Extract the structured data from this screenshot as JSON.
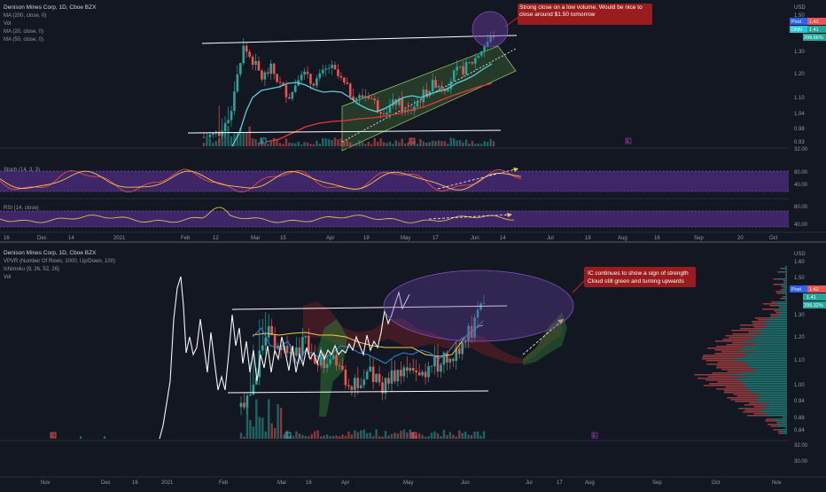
{
  "colors": {
    "background": "#131722",
    "grid": "#1f2330",
    "up": "#26a69a",
    "down": "#ef5350",
    "ma20": "#5ad1d9",
    "ma50": "#e53935",
    "channel": "#9ccc65",
    "purple_band": "#4a2b7a",
    "stoch_k": "#e84b4b",
    "stoch_d": "#f2c94c",
    "rsi": "#d4c04a",
    "annotation_bg": "#9b1c1c",
    "ellipse": "#7b4fb8",
    "label_blue": "#26c6da",
    "label_red": "#ef5350"
  },
  "top_panel": {
    "legend": [
      "Denison Mines Corp, 1D, Cboe BZX",
      "MA (200, close, 0)",
      "Vol",
      "MA (20, close, 0)",
      "MA (50, close, 0)"
    ],
    "currency": "USD",
    "price_ticks": [
      "1.50",
      "1.42",
      "1.41",
      "1.30",
      "1.20",
      "1.10",
      "1.04",
      "0.98",
      "0.93",
      "32.00"
    ],
    "post_label": "Post",
    "post_price": "1.42",
    "dnn_label": "DNN",
    "dnn_price": "1.41",
    "pct_label": "299.66%",
    "annotation": "Strong close on a low volume. Would be nice to close around $1.50 tomorrow",
    "stoch_legend": "Stoch (14, 3, 3)",
    "stoch_ticks": [
      "80.00",
      "40.00"
    ],
    "rsi_legend": "RSI (14, close)",
    "rsi_ticks": [
      "80.00",
      "40.00"
    ],
    "time_axis": [
      "16",
      "Dec",
      "14",
      "2021",
      "Feb",
      "12",
      "Mar",
      "15",
      "Apr",
      "19",
      "May",
      "17",
      "Jun",
      "14",
      "Jul",
      "19",
      "Aug",
      "16",
      "Sep",
      "20",
      "Oct"
    ],
    "marker_letters": [
      "E",
      "E",
      "E"
    ]
  },
  "bottom_panel": {
    "legend": [
      "Denison Mines Corp, 1D, Cboe BZX",
      "VPVR (Number Of Rows, 1000, Up/Down, 100)",
      "Ichimoku (9, 26, 52, 26)",
      "Vol"
    ],
    "currency": "USD",
    "price_ticks": [
      "1.60",
      "1.50",
      "1.42",
      "1.41",
      "1.30",
      "1.20",
      "1.10",
      "1.00",
      "0.94",
      "0.88",
      "0.84",
      "32.00",
      "30.00"
    ],
    "post_label": "Post",
    "post_price": "1.42",
    "dnn_label": "DNN",
    "dnn_price": "1.41",
    "pct_label": "299.32%",
    "annotation_line1": "IC continues to show a sign of strength",
    "annotation_line2": "Cloud still green and turning upwards",
    "time_axis": [
      "Nov",
      "Dec",
      "16",
      "2021",
      "Feb",
      "Mar",
      "16",
      "Apr",
      "May",
      "Jun",
      "Jul",
      "17",
      "Aug",
      "Sep",
      "Oct",
      "Nov"
    ],
    "marker_letters": [
      "E",
      "E",
      "E",
      "E"
    ]
  },
  "chart_data": [
    {
      "type": "candlestick",
      "title": "Denison Mines Corp, 1D, Cboe BZX",
      "ylim": [
        0.92,
        1.55
      ],
      "support_level": 0.98,
      "resistance_level": 1.4,
      "last_close": 1.41,
      "approx_closes": [
        0.96,
        0.97,
        0.99,
        1.1,
        1.36,
        1.3,
        1.22,
        1.26,
        1.18,
        1.14,
        1.26,
        1.2,
        1.22,
        1.27,
        1.22,
        1.16,
        1.13,
        1.15,
        1.09,
        1.08,
        1.12,
        1.06,
        1.11,
        1.16,
        1.2,
        1.18,
        1.24,
        1.26,
        1.3,
        1.36,
        1.41
      ],
      "volume_peak_month": "Feb",
      "stoch_range": [
        0,
        100
      ],
      "rsi_range": [
        20,
        90
      ]
    },
    {
      "type": "candlestick",
      "title": "Denison Mines Corp, 1D, Cboe BZX",
      "ylim": [
        0.82,
        1.62
      ],
      "support_level": 0.97,
      "resistance_level": 1.34,
      "last_close": 1.41,
      "ichimoku": "Ichimoku (9, 26, 52, 26)",
      "vpvr": "VPVR (Number Of Rows, 1000, Up/Down, 100)"
    }
  ]
}
